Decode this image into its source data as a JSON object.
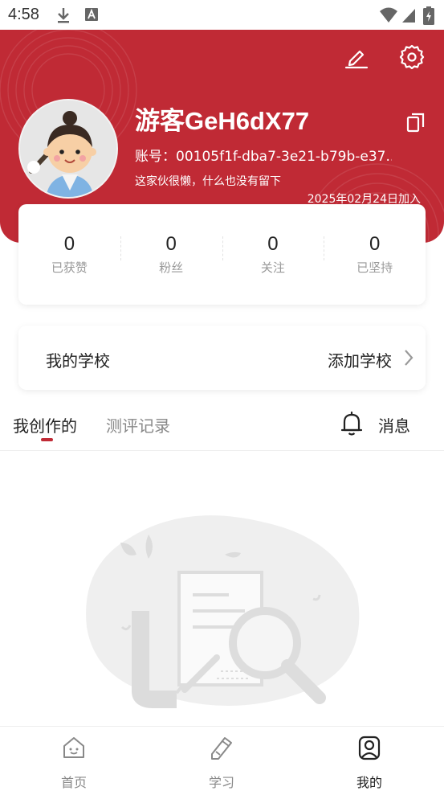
{
  "status_bar": {
    "time": "4:58"
  },
  "profile": {
    "username": "游客GeH6dX77",
    "account_label": "账号：",
    "account_id": "00105f1f-dba7-3e21-b79b-e37...",
    "bio": "这家伙很懒，什么也没有留下",
    "joined": "2025年02月24日加入"
  },
  "stats": [
    {
      "value": "0",
      "label": "已获赞"
    },
    {
      "value": "0",
      "label": "粉丝"
    },
    {
      "value": "0",
      "label": "关注"
    },
    {
      "value": "0",
      "label": "已坚持"
    }
  ],
  "school": {
    "title": "我的学校",
    "action": "添加学校"
  },
  "tabs": {
    "active": "我创作的",
    "inactive": "测评记录",
    "messages": "消息"
  },
  "bottom_nav": [
    {
      "label": "首页",
      "icon": "home-icon"
    },
    {
      "label": "学习",
      "icon": "pencil-icon"
    },
    {
      "label": "我的",
      "icon": "profile-icon"
    }
  ],
  "colors": {
    "accent": "#c02a35",
    "background": "#ffffff"
  }
}
